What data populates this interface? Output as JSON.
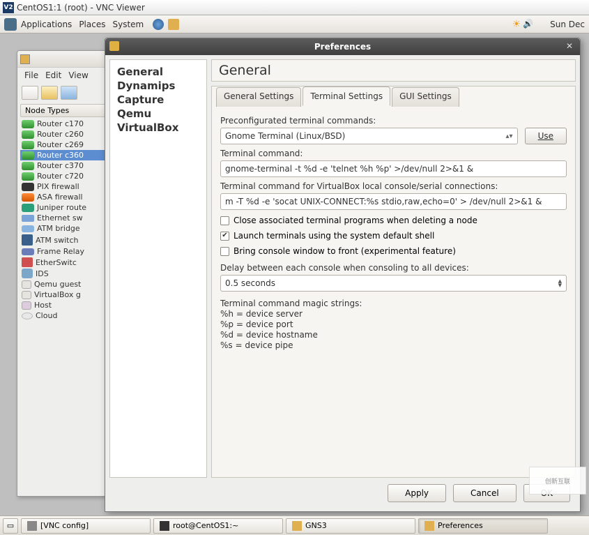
{
  "vnc": {
    "title": "CentOS1:1 (root) - VNC Viewer"
  },
  "gnome": {
    "apps": "Applications",
    "places": "Places",
    "system": "System",
    "clock": "Sun Dec"
  },
  "gns3": {
    "menu": {
      "file": "File",
      "edit": "Edit",
      "view": "View"
    },
    "panel_title": "Node Types",
    "nodes": [
      "Router c170",
      "Router c260",
      "Router c269",
      "Router c360",
      "Router c370",
      "Router c720",
      "PIX firewall",
      "ASA firewall",
      "Juniper route",
      "Ethernet sw",
      "ATM bridge",
      "ATM switch",
      "Frame Relay",
      "EtherSwitc",
      "IDS",
      "Qemu guest",
      "VirtualBox g",
      "Host",
      "Cloud"
    ],
    "selected_index": 3
  },
  "prefs": {
    "title": "Preferences",
    "categories": [
      "General",
      "Dynamips",
      "Capture",
      "Qemu",
      "VirtualBox"
    ],
    "section": "General",
    "tabs": [
      "General Settings",
      "Terminal Settings",
      "GUI Settings"
    ],
    "active_tab": 1,
    "labels": {
      "preconf": "Preconfigurated terminal commands:",
      "combo_value": "Gnome Terminal (Linux/BSD)",
      "use": "Use",
      "termcmd": "Terminal command:",
      "termcmd_val": "gnome-terminal -t %d -e 'telnet %h %p' >/dev/null 2>&1 &",
      "vbcmd": "Terminal command for VirtualBox local console/serial connections:",
      "vbcmd_val": "m -T %d -e 'socat UNIX-CONNECT:%s stdio,raw,echo=0' > /dev/null 2>&1 &",
      "close_assoc": "Close associated terminal programs when deleting a node",
      "launch_shell": "Launch terminals using the system default shell",
      "bring_front": "Bring console window to front (experimental feature)",
      "delay_label": "Delay between each console when consoling to all devices:",
      "delay_value": "0.5 seconds",
      "magic_head": "Terminal command magic strings:",
      "magic_h": "%h = device server",
      "magic_p": "%p = device port",
      "magic_d": "%d = device hostname",
      "magic_s": "%s = device pipe"
    },
    "checks": {
      "close_assoc": false,
      "launch_shell": true,
      "bring_front": false
    },
    "buttons": {
      "apply": "Apply",
      "cancel": "Cancel",
      "ok": "OK"
    }
  },
  "taskbar": {
    "items": [
      "[VNC config]",
      "root@CentOS1:~",
      "GNS3",
      "Preferences"
    ],
    "active_index": 3
  },
  "watermark": "创新互联"
}
